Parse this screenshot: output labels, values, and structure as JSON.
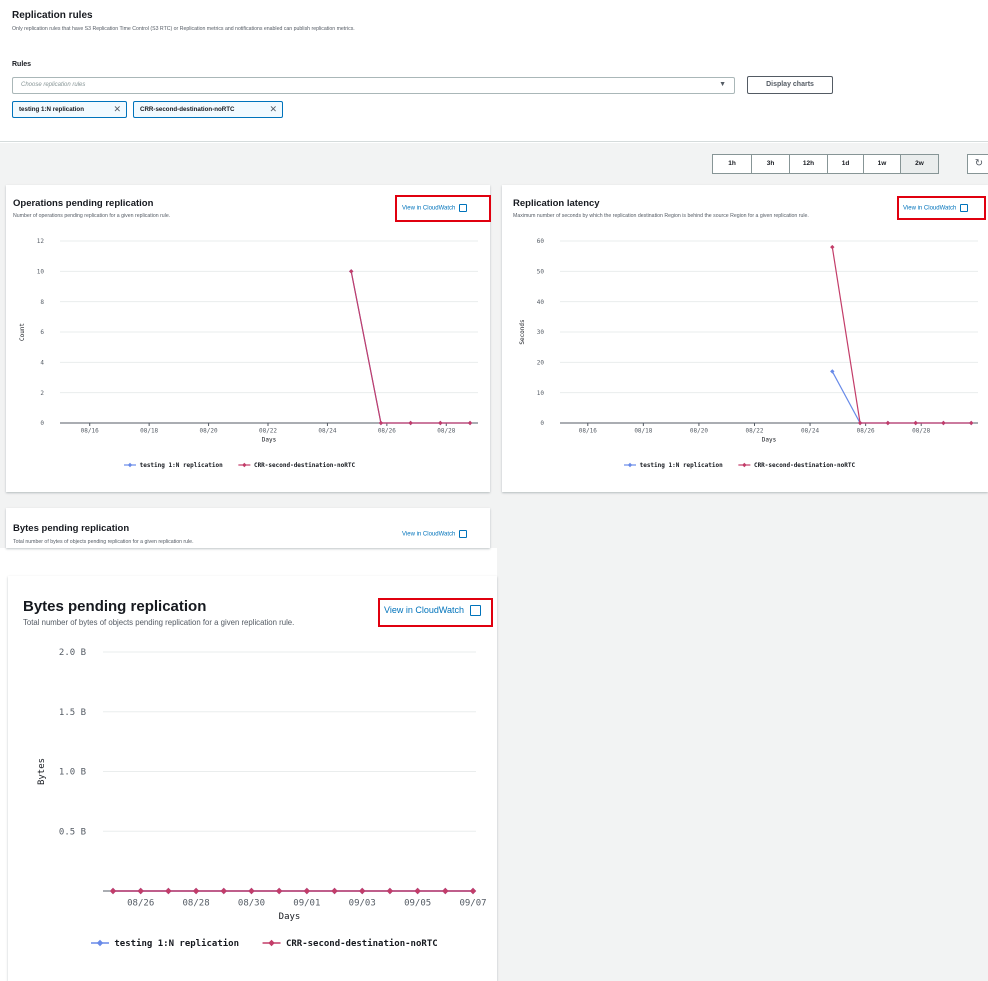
{
  "rules_panel": {
    "title": "Replication rules",
    "description": "Only replication rules that have S3 Replication Time Control (S3 RTC) or Replication metrics and notifications enabled can publish replication metrics.",
    "rules_label": "Rules",
    "select_placeholder": "Choose replication rules",
    "display_button": "Display charts",
    "tokens": [
      "testing 1:N replication",
      "CRR-second-destination-noRTC"
    ]
  },
  "time_range": {
    "options": [
      "1h",
      "3h",
      "12h",
      "1d",
      "1w",
      "2w"
    ],
    "selected": "2w"
  },
  "link_label": "View in CloudWatch",
  "series_names": [
    "testing 1:N replication",
    "CRR-second-destination-noRTC"
  ],
  "colors": {
    "series1": "#688ae8",
    "series2": "#c33d69",
    "link": "#0073bb",
    "highlight": "#e0000f"
  },
  "cards": {
    "operations": {
      "title": "Operations pending replication",
      "description": "Number of operations pending replication for a given replication rule."
    },
    "latency": {
      "title": "Replication latency",
      "description": "Maximum number of seconds by which the replication destination Region is behind the source Region for a given replication rule."
    },
    "bytes_small": {
      "title": "Bytes pending replication",
      "description": "Total number of bytes of objects pending replication for a given replication rule."
    },
    "bytes_large": {
      "title": "Bytes pending replication",
      "description": "Total number of bytes of objects pending replication for a given replication rule."
    }
  },
  "chart_data": [
    {
      "id": "operations",
      "type": "line",
      "ylabel": "Count",
      "xlabel": "Days",
      "ylim": [
        0,
        12
      ],
      "yticks": [
        "0",
        "2",
        "4",
        "6",
        "8",
        "10",
        "12"
      ],
      "xticks": [
        "08/16",
        "08/18",
        "08/20",
        "08/22",
        "08/24",
        "08/26",
        "08/28"
      ],
      "series": [
        {
          "name": "testing 1:N replication",
          "x": [
            24.8,
            25.8,
            26.8,
            27.8,
            28.8
          ],
          "y": [
            10,
            0,
            0,
            0,
            0
          ]
        },
        {
          "name": "CRR-second-destination-noRTC",
          "x": [
            24.8,
            25.8,
            26.8,
            27.8,
            28.8
          ],
          "y": [
            10,
            0,
            0,
            0,
            0
          ]
        }
      ]
    },
    {
      "id": "latency",
      "type": "line",
      "ylabel": "Seconds",
      "xlabel": "Days",
      "ylim": [
        0,
        60
      ],
      "yticks": [
        "0",
        "10",
        "20",
        "30",
        "40",
        "50",
        "60"
      ],
      "xticks": [
        "08/16",
        "08/18",
        "08/20",
        "08/22",
        "08/24",
        "08/26",
        "08/28"
      ],
      "series": [
        {
          "name": "testing 1:N replication",
          "x": [
            24.8,
            25.8,
            26.8,
            27.8,
            28.8,
            29.8
          ],
          "y": [
            17,
            0,
            0,
            0,
            0,
            0
          ]
        },
        {
          "name": "CRR-second-destination-noRTC",
          "x": [
            24.8,
            25.8,
            26.8,
            27.8,
            28.8,
            29.8
          ],
          "y": [
            58,
            0,
            0,
            0,
            0,
            0
          ]
        }
      ]
    },
    {
      "id": "bytes",
      "type": "line",
      "ylabel": "Bytes",
      "xlabel": "Days",
      "ylim": [
        0,
        2.0
      ],
      "yticks": [
        "0.5 B",
        "1.0 B",
        "1.5 B",
        "2.0 B"
      ],
      "xticks": [
        "08/26",
        "08/28",
        "08/30",
        "09/01",
        "09/03",
        "09/05",
        "09/07"
      ],
      "series": [
        {
          "name": "testing 1:N replication",
          "x": [
            25,
            26,
            27,
            28,
            29,
            30,
            31,
            32,
            33,
            34,
            35,
            36,
            37,
            38
          ],
          "y": [
            0,
            0,
            0,
            0,
            0,
            0,
            0,
            0,
            0,
            0,
            0,
            0,
            0,
            0
          ]
        },
        {
          "name": "CRR-second-destination-noRTC",
          "x": [
            25,
            26,
            27,
            28,
            29,
            30,
            31,
            32,
            33,
            34,
            35,
            36,
            37,
            38
          ],
          "y": [
            0,
            0,
            0,
            0,
            0,
            0,
            0,
            0,
            0,
            0,
            0,
            0,
            0,
            0
          ]
        }
      ]
    }
  ]
}
